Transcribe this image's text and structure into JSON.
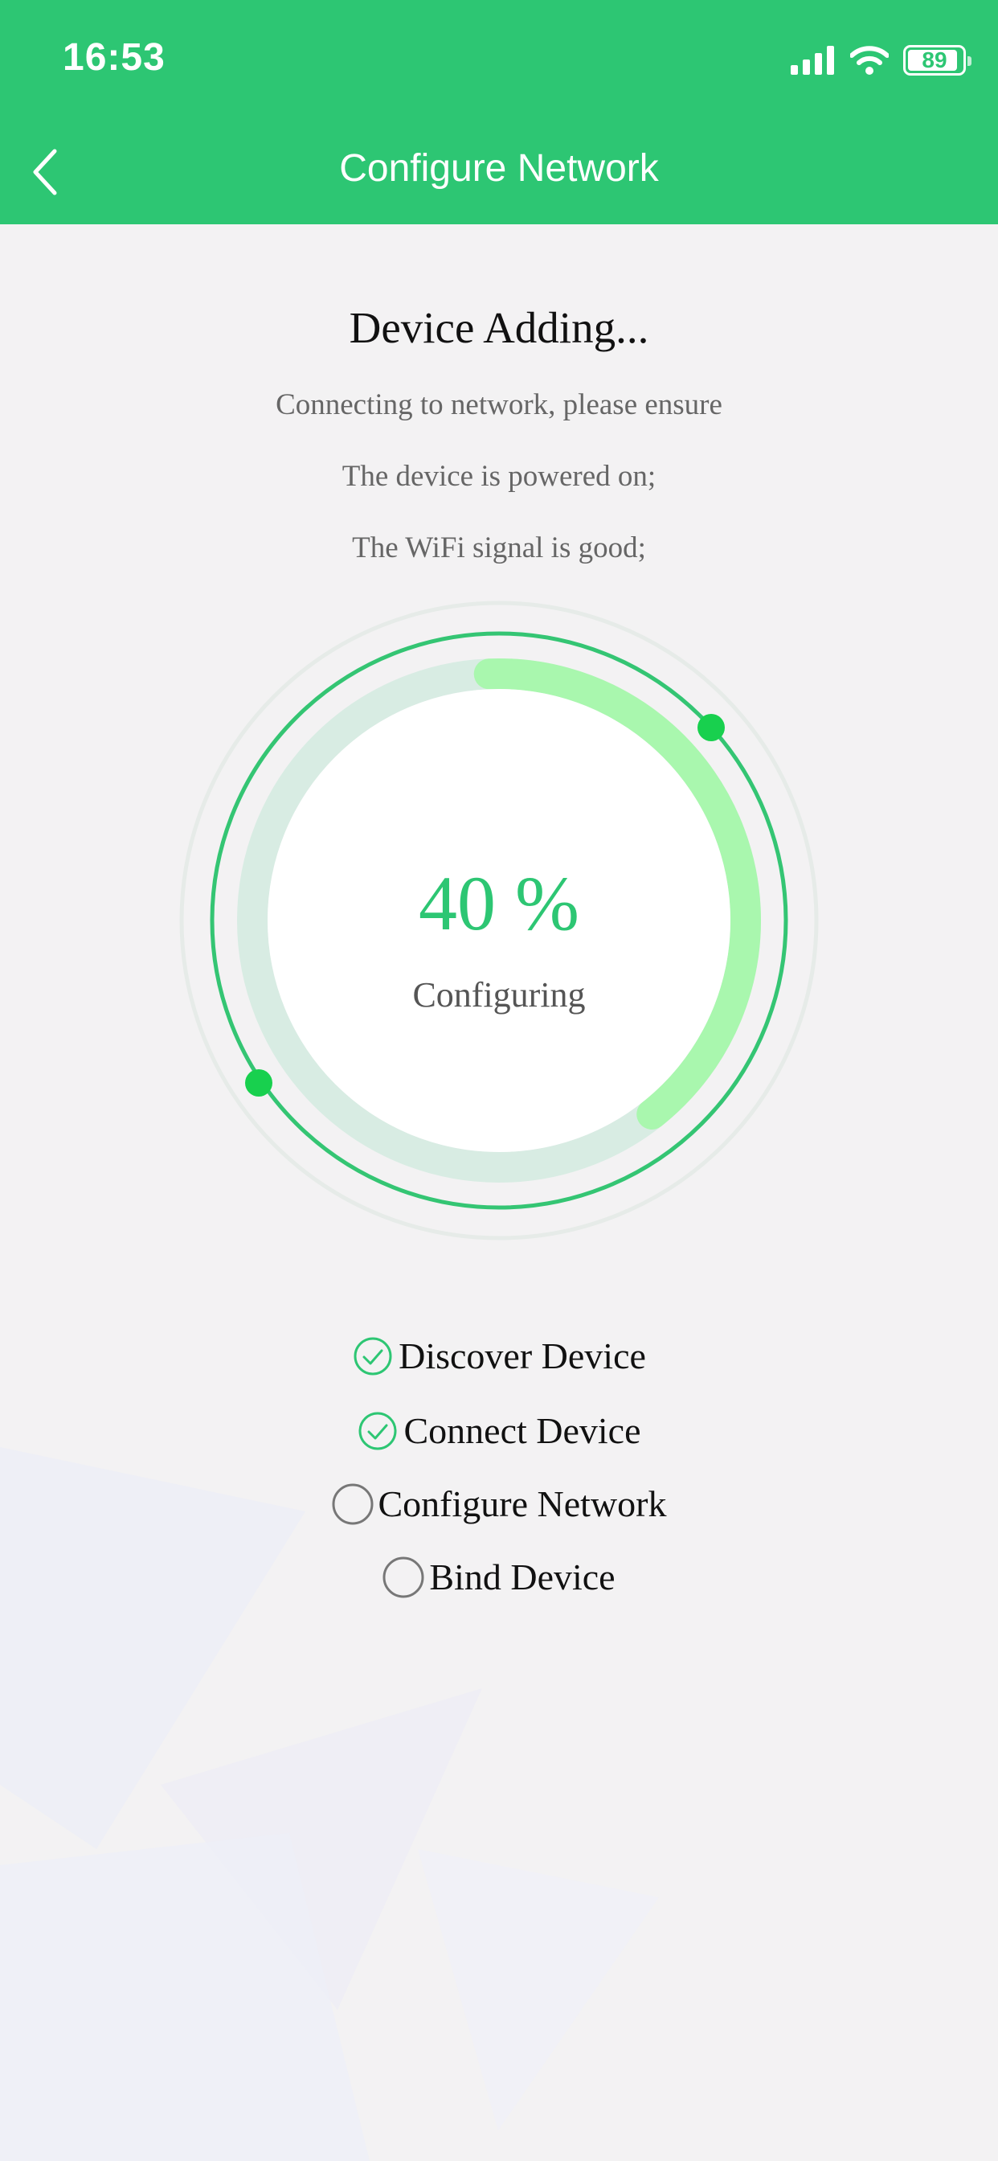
{
  "status_bar": {
    "time": "16:53",
    "battery": "89",
    "battery_level": 0.89
  },
  "header": {
    "title": "Configure Network"
  },
  "main": {
    "heading": "Device Adding...",
    "hints": [
      "Connecting to network, please ensure",
      "The device is powered on;",
      "The WiFi signal is good;"
    ],
    "progress": {
      "percent_label": "40 %",
      "value": 40,
      "status": "Configuring"
    }
  },
  "steps": [
    {
      "label": "Discover Device",
      "done": true
    },
    {
      "label": "Connect Device",
      "done": true
    },
    {
      "label": "Configure Network",
      "done": false
    },
    {
      "label": "Bind Device",
      "done": false
    }
  ],
  "colors": {
    "accent": "#2dc673",
    "progress": "#a9f7ae",
    "dot": "#18d04e"
  }
}
